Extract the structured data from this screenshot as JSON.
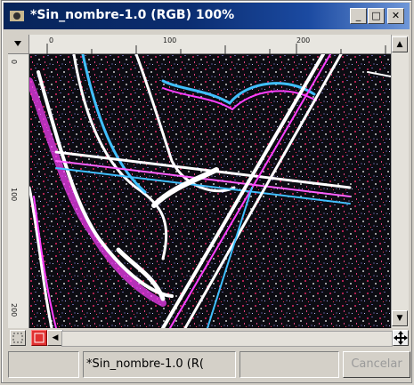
{
  "window": {
    "title": "*Sin_nombre-1.0 (RGB) 100%",
    "controls": {
      "minimize": "_",
      "maximize": "□",
      "close": "✕"
    }
  },
  "rulers": {
    "horizontal_labels": [
      "0",
      "100",
      "200"
    ],
    "vertical_labels": [
      "0",
      "100",
      "200"
    ]
  },
  "statusbar": {
    "image_name": "*Sin_nombre-1.0 (R(",
    "cancel_label": "Cancelar"
  },
  "icons": {
    "window_icon": "gimp-icon",
    "quick_mask": "quickmask-icon",
    "navigate": "navigate-icon"
  },
  "colors": {
    "titlebar": "#0b2d70",
    "canvas_lines": [
      "#ff40ff",
      "#40c0ff",
      "#ffffff"
    ]
  }
}
